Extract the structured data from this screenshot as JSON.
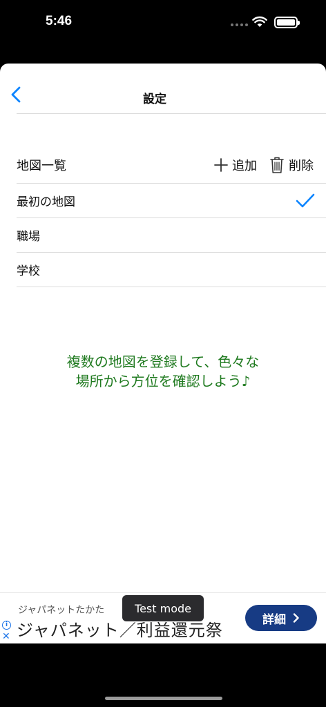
{
  "status_bar": {
    "time": "5:46"
  },
  "nav": {
    "title": "設定"
  },
  "list": {
    "header_title": "地図一覧",
    "add_label": "追加",
    "delete_label": "削除",
    "items": [
      {
        "label": "最初の地図",
        "selected": true
      },
      {
        "label": "職場",
        "selected": false
      },
      {
        "label": "学校",
        "selected": false
      }
    ]
  },
  "promo": {
    "line1": "複数の地図を登録して、色々な",
    "line2": "場所から方位を確認しよう♪"
  },
  "ad": {
    "advertiser": "ジャパネットたかた",
    "headline": "ジャパネット／利益還元祭",
    "cta_label": "詳細",
    "test_mode": "Test mode"
  },
  "colors": {
    "accent": "#0a84ff",
    "promo_text": "#1f7a1f",
    "ad_button": "#173b84"
  }
}
